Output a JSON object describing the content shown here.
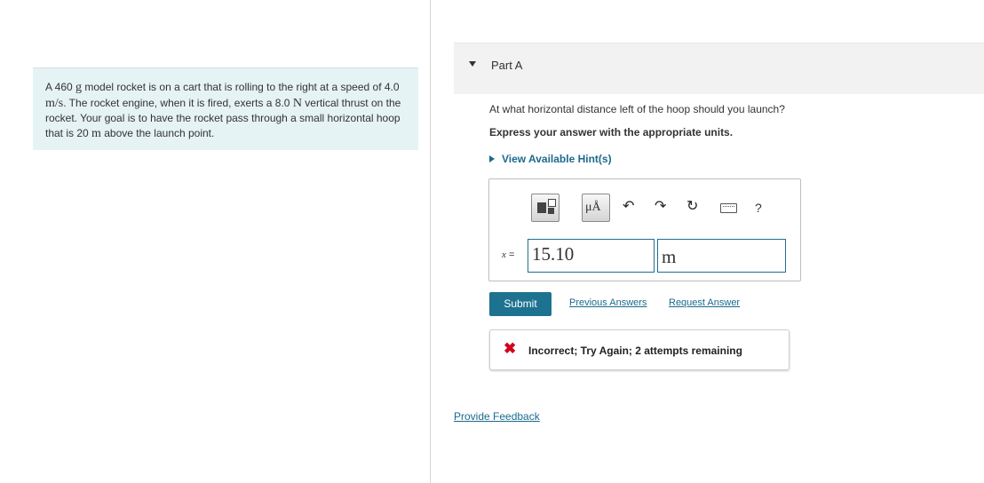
{
  "problem": {
    "t1": "A 460 ",
    "u_g": "g",
    "t2": " model rocket is on a cart that is rolling to the right at a speed of 4.0 ",
    "u_ms": "m/s",
    "t3": ". The rocket engine, when it is fired, exerts a 8.0 ",
    "u_N": "N",
    "t4": " vertical thrust on the rocket. Your goal is to have the rocket pass through a small horizontal hoop that is 20 ",
    "u_m": "m",
    "t5": " above the launch point."
  },
  "part": {
    "title": "Part A"
  },
  "question": "At what horizontal distance left of the hoop should you launch?",
  "instruction": "Express your answer with the appropriate units.",
  "hints_label": "View Available Hint(s)",
  "toolbar": {
    "units_label": "μÅ",
    "undo_glyph": "↶",
    "redo_glyph": "↷",
    "reset_glyph": "↻",
    "help_glyph": "?",
    "icons": [
      "templates-icon",
      "units-icon",
      "undo-icon",
      "redo-icon",
      "reset-icon",
      "keyboard-icon",
      "help-icon"
    ]
  },
  "answer": {
    "variable": "x",
    "equals": " =",
    "value": "15.10",
    "unit": "m"
  },
  "actions": {
    "submit": "Submit",
    "previous_answers": "Previous Answers",
    "request_answer": "Request Answer"
  },
  "feedback": {
    "icon_glyph": "✖",
    "message": "Incorrect; Try Again; 2 attempts remaining"
  },
  "provide_feedback": "Provide Feedback",
  "colors": {
    "accent": "#1d7290",
    "link": "#1b6a8c",
    "error": "#d0021b",
    "problem_bg": "#e5f3f5",
    "header_bg": "#f2f2f2"
  }
}
